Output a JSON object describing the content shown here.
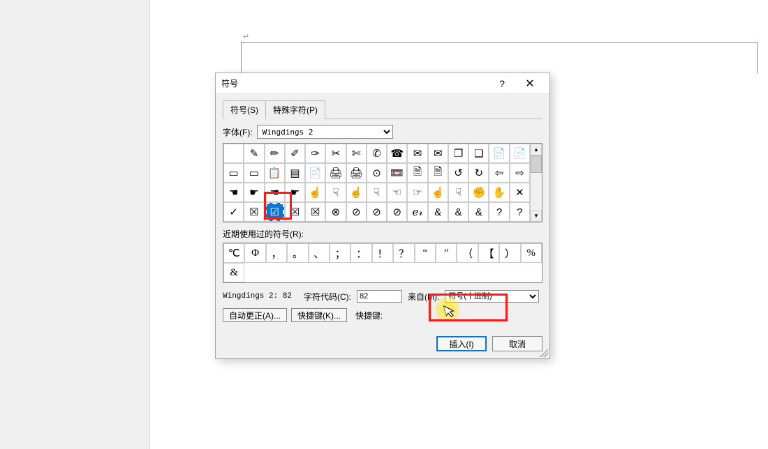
{
  "dialog": {
    "title": "符号",
    "tabs": {
      "symbols": "符号(S)",
      "special": "特殊字符(P)"
    },
    "font_label": "字体(F):",
    "font_value": "Wingdings 2",
    "symbols_grid": [
      [
        " ",
        "✎",
        "✏",
        "✐",
        "✑",
        "✂",
        "✄",
        "✆",
        "☎",
        "✉",
        "✉",
        "❐",
        "❑",
        "📄",
        "📄"
      ],
      [
        "▭",
        "▭",
        "📋",
        "▤",
        "📄",
        "🖨",
        "🖨",
        "⊙",
        "📼",
        "🗎",
        "🗎",
        "↺",
        "↻",
        "⇦",
        "⇨"
      ],
      [
        "☚",
        "☛",
        "☚",
        "☛",
        "☝",
        "☟",
        "☝",
        "☟",
        "☜",
        "☞",
        "☝",
        "☟",
        "✊",
        "✋",
        "✕"
      ],
      [
        "✓",
        "☒",
        "☑",
        "☒",
        "☒",
        "⊗",
        "⊘",
        "⊘",
        "⊘",
        "ℯ𝓇",
        "&",
        "&",
        "&",
        "?",
        "?"
      ]
    ],
    "selected_row": 3,
    "selected_col": 2,
    "recent_label": "近期使用过的符号(R):",
    "recent_symbols": [
      "℃",
      "Φ",
      "，",
      "。",
      "、",
      "；",
      "：",
      "！",
      "？",
      "“",
      "”",
      "（",
      "【",
      "）",
      "%",
      "&"
    ],
    "unicode_name_label": "Wingdings 2: 82",
    "charcode_label": "字符代码(C):",
    "charcode_value": "82",
    "from_label": "来自(M):",
    "from_value": "符号(十进制)",
    "autocorrect_btn": "自动更正(A)...",
    "shortcut_btn": "快捷键(K)...",
    "shortcut_label": "快捷键:",
    "insert_btn": "插入(I)",
    "cancel_btn": "取消"
  }
}
